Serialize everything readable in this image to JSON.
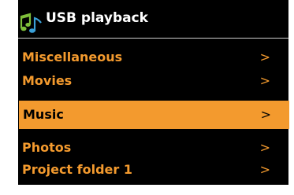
{
  "header": {
    "title": "USB playback",
    "icon": "music-notes-icon"
  },
  "menu": {
    "items": [
      {
        "label": "Miscellaneous",
        "arrow": ">",
        "selected": false
      },
      {
        "label": "Movies",
        "arrow": ">",
        "selected": false
      },
      {
        "label": "Music",
        "arrow": ">",
        "selected": true
      },
      {
        "label": "Photos",
        "arrow": ">",
        "selected": false
      },
      {
        "label": "Project folder 1",
        "arrow": ">",
        "selected": false
      }
    ]
  },
  "colors": {
    "background": "#000000",
    "accent": "#f39a2e",
    "title": "#ffffff",
    "selected_text": "#000000"
  }
}
